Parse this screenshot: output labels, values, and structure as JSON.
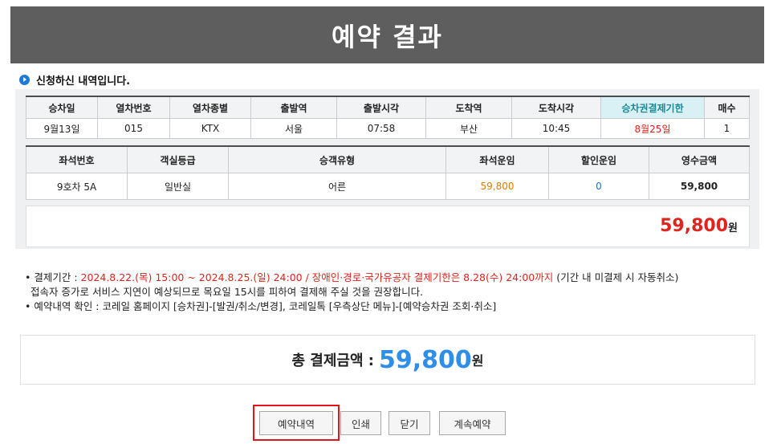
{
  "page": {
    "title": "예약 결과"
  },
  "section": {
    "title": "신청하신 내역입니다."
  },
  "train_table": {
    "headers": [
      "승차일",
      "열차번호",
      "열차종별",
      "출발역",
      "출발시각",
      "도착역",
      "도착시각",
      "승차권결제기한",
      "매수"
    ],
    "row": [
      "9월13일",
      "015",
      "KTX",
      "서울",
      "07:58",
      "부산",
      "10:45",
      "8월25일",
      "1"
    ]
  },
  "seat_table": {
    "headers": [
      "좌석번호",
      "객실등급",
      "승객유형",
      "좌석운임",
      "할인운임",
      "영수금액"
    ],
    "row": [
      "9호차 5A",
      "일반실",
      "어른",
      "59,800",
      "0",
      "59,800"
    ]
  },
  "subtotal": {
    "amount": "59,800",
    "unit": "원"
  },
  "notes": {
    "line1_prefix": "• 결제기간 : ",
    "line1_red": "2024.8.22.(목) 15:00 ~ 2024.8.25.(일) 24:00 / 장애인·경로·국가유공자 결제기한은 8.28(수) 24:00까지",
    "line1_suffix": " (기간 내 미결제 시 자동취소)",
    "line2": "접속자 증가로 서비스 지연이 예상되므로 목요일 15시를 피하여 결제해 주실 것을 권장합니다.",
    "line3": "• 예약내역 확인 : 코레일 홈페이지 [승차권]-[발권/취소/변경], 코레일톡 [우측상단 메뉴]-[예약승차권 조회·취소]"
  },
  "grand_total": {
    "label": "총 결제금액 :",
    "amount": "59,800",
    "unit": "원"
  },
  "buttons": {
    "reservation": "예약내역",
    "print": "인쇄",
    "close": "닫기",
    "continue": "계속예약"
  },
  "colors": {
    "header_bg": "#5e5e5e",
    "accent_red": "#e0231d",
    "accent_blue": "#2e8ee8",
    "highlight_border": "#e3141a"
  }
}
